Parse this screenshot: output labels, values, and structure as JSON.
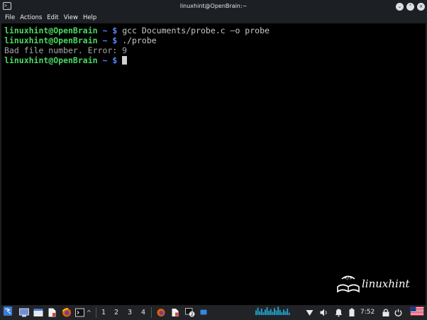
{
  "window": {
    "title": "linuxhint@OpenBrain:~",
    "controls": [
      "minimize",
      "maximize",
      "close"
    ]
  },
  "menu": {
    "items": [
      "File",
      "Actions",
      "Edit",
      "View",
      "Help"
    ]
  },
  "terminal": {
    "lines": [
      {
        "user": "linuxhint@OpenBrain",
        "path": " ~ ",
        "symbol": "$",
        "command": " gcc Documents/probe.c –o probe"
      },
      {
        "user": "linuxhint@OpenBrain",
        "path": " ~ ",
        "symbol": "$",
        "command": " ./probe"
      },
      {
        "output": "Bad file number. Error: 9"
      },
      {
        "user": "linuxhint@OpenBrain",
        "path": " ~ ",
        "symbol": "$",
        "command": " "
      }
    ]
  },
  "watermark": {
    "brand": "linuxhint"
  },
  "taskbar": {
    "workspaces": [
      "1",
      "2",
      "3",
      "4"
    ],
    "badge_count": "2",
    "clock": "7:52",
    "icons": [
      "kali-menu-icon",
      "desktop-icon",
      "file-manager-icon",
      "text-editor-icon",
      "firefox-icon",
      "terminal-icon",
      "chevron-up-icon",
      "firefox-window-icon",
      "editor-window-icon",
      "terminal-window-icon",
      "network-icon",
      "volume-icon",
      "notifications-icon",
      "battery-icon",
      "lock-icon",
      "power-icon",
      "flag-us-icon"
    ]
  },
  "colors": {
    "prompt_user": "#4cd964",
    "prompt_symbol": "#5a86ff",
    "background": "#000000",
    "chrome": "#1c1f24"
  }
}
